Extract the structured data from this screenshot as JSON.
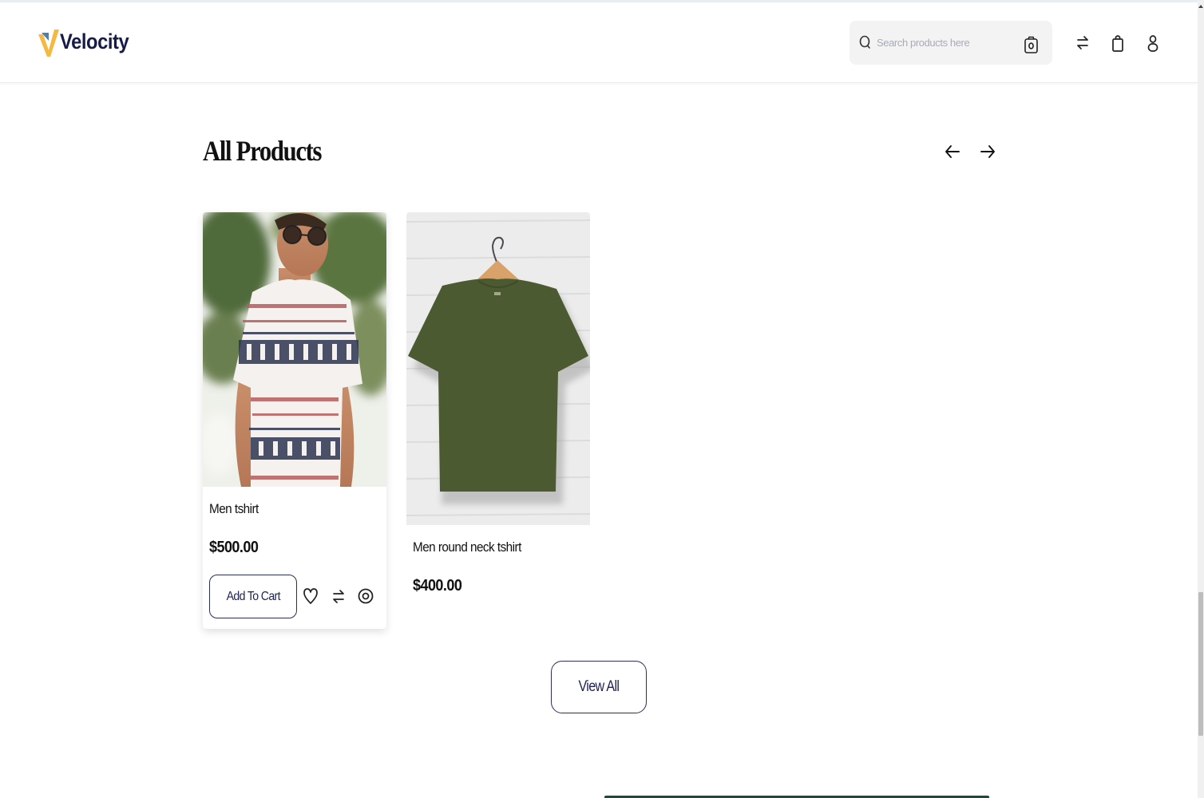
{
  "brand": {
    "name": "Velocity",
    "colors": {
      "navy": "#161c47",
      "accent_yellow": "#f5b942",
      "accent_blue": "#4a7fb0"
    }
  },
  "header": {
    "search": {
      "placeholder": "Search products here",
      "value": ""
    },
    "icons": [
      "search-icon",
      "camera-icon",
      "compare-icon",
      "shopping-bag-icon",
      "user-icon"
    ]
  },
  "section": {
    "title": "All Products",
    "nav": {
      "prev": "arrow-left-icon",
      "next": "arrow-right-icon"
    }
  },
  "products": [
    {
      "name": "Men tshirt",
      "price": "$500.00",
      "image": "man in white patterned t-shirt with sunglasses",
      "actions": {
        "add_to_cart": "Add To Cart",
        "icons": [
          "heart-icon",
          "compare-icon",
          "quick-view-icon"
        ]
      }
    },
    {
      "name": "Men round neck tshirt",
      "price": "$400.00",
      "image": "olive green round neck t-shirt on hanger"
    }
  ],
  "view_all_label": "View All"
}
